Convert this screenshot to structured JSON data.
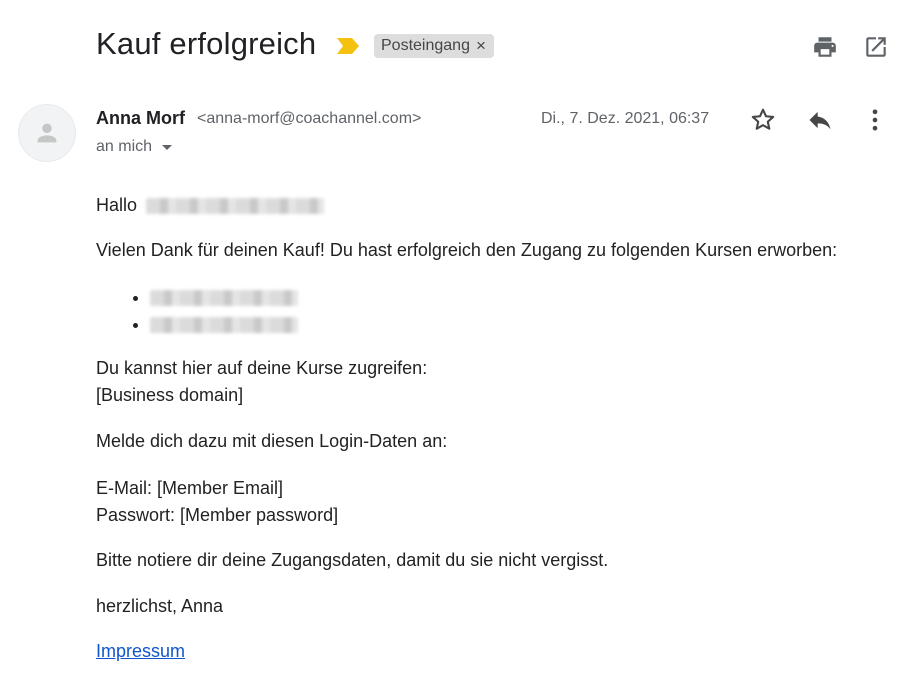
{
  "header": {
    "subject": "Kauf erfolgreich",
    "label": "Posteingang",
    "label_close": "×"
  },
  "message": {
    "sender_name": "Anna Morf",
    "sender_email": "<anna-morf@coachannel.com>",
    "recipient": "an mich",
    "date": "Di., 7. Dez. 2021, 06:37"
  },
  "body": {
    "greeting": "Hallo",
    "thanks": "Vielen Dank für deinen Kauf! Du hast erfolgreich den Zugang zu folgenden Kursen erworben:",
    "access_line": "Du kannst hier auf deine Kurse zugreifen:",
    "domain": "[Business domain]",
    "login_intro": "Melde dich dazu mit diesen Login-Daten an:",
    "email_line": "E-Mail: [Member Email]",
    "password_line": "Passwort: [Member password]",
    "note": "Bitte notiere dir deine Zugangsdaten, damit du sie nicht vergisst.",
    "signoff": "herzlichst, Anna",
    "impressum": "Impressum"
  },
  "icons": {
    "important": "important-marker-icon",
    "print": "print-icon",
    "open_new_window": "open-in-new-window-icon",
    "star": "star-icon",
    "reply": "reply-icon",
    "more": "more-vert-icon",
    "avatar": "person-icon"
  },
  "colors": {
    "important_marker": "#f4c20d",
    "link": "#1155cc",
    "chip_bg": "#dddddd"
  }
}
